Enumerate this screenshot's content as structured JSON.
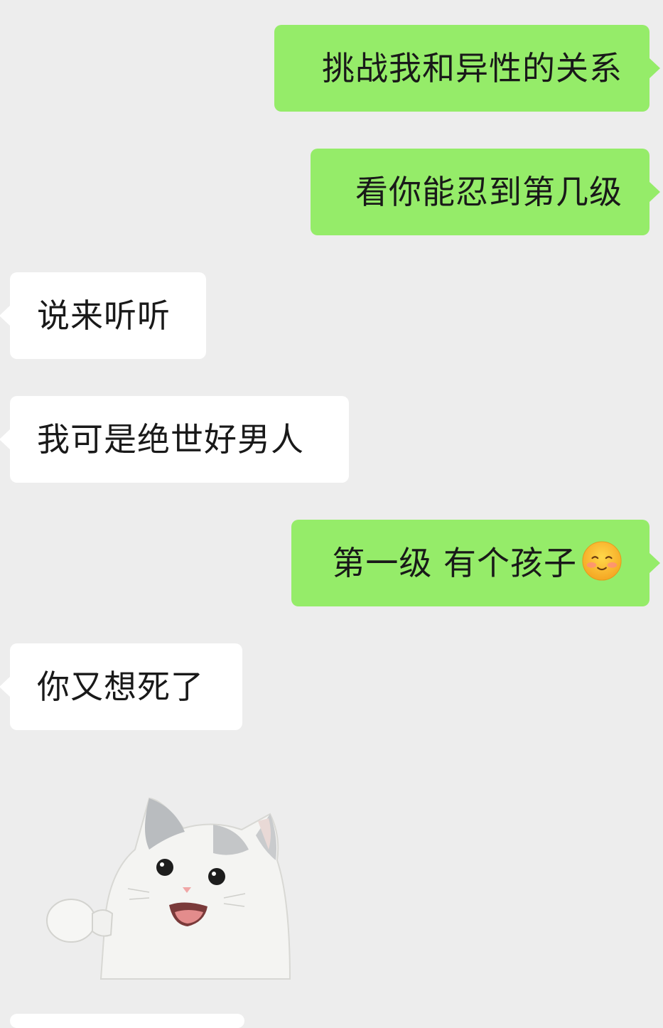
{
  "messages": [
    {
      "side": "sent",
      "text": "挑战我和异性的关系"
    },
    {
      "side": "sent",
      "text": "看你能忍到第几级"
    },
    {
      "side": "recv",
      "text": "说来听听"
    },
    {
      "side": "recv",
      "text": "我可是绝世好男人"
    },
    {
      "side": "sent",
      "text": "第一级 有个孩子",
      "emoji": "shy-smile-emoji"
    },
    {
      "side": "recv",
      "text": "你又想死了"
    },
    {
      "side": "recv",
      "sticker": "cat-sticker"
    }
  ],
  "colors": {
    "background": "#ededed",
    "sent_bubble": "#95ec69",
    "recv_bubble": "#ffffff",
    "text": "#191919"
  }
}
